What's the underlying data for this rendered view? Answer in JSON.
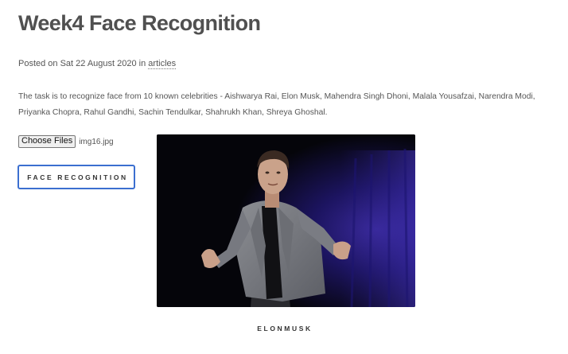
{
  "post": {
    "title": "Week4 Face Recognition",
    "meta": {
      "posted_prefix": "Posted on Sat 22 August 2020 in ",
      "category": "articles"
    },
    "description": "The task is to recognize face from 10 known celebrities - Aishwarya Rai, Elon Musk, Mahendra Singh Dhoni, Malala Yousafzai, Narendra Modi, Priyanka Chopra, Rahul Gandhi, Sachin Tendulkar, Shahrukh Khan, Shreya Ghoshal."
  },
  "uploader": {
    "button_label": "Choose Files",
    "file_name": "img16.jpg"
  },
  "action": {
    "button_label": "FACE RECOGNITION"
  },
  "result": {
    "label": "ELONMUSK"
  },
  "colors": {
    "title": "#505050",
    "button_border": "#3b6fd0",
    "photo_background": "#05050a",
    "stage_light": "#3a2a9a"
  }
}
